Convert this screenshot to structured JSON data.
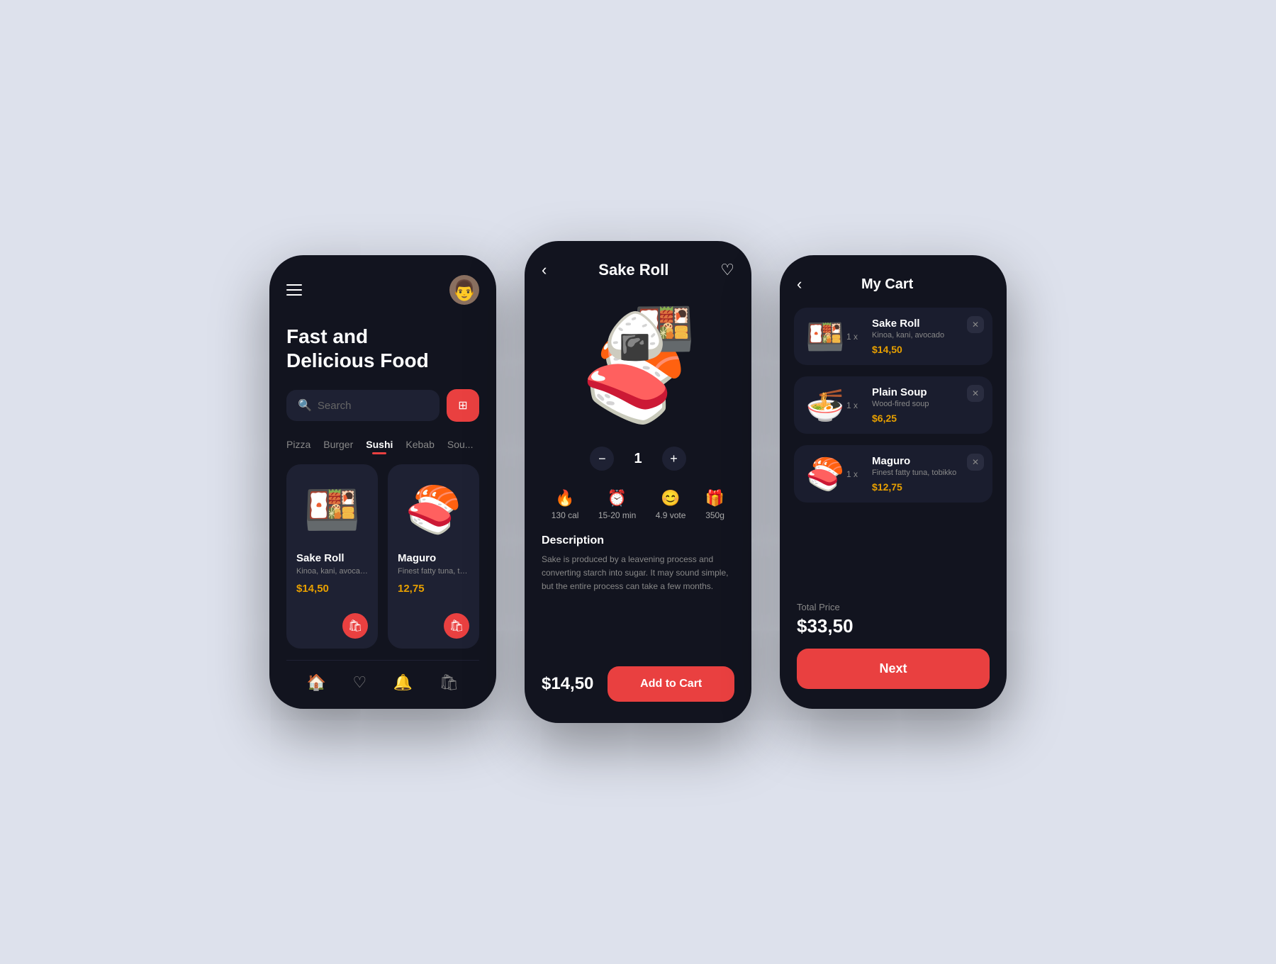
{
  "background": "#dde1ec",
  "phone1": {
    "title_line1": "Fast and",
    "title_line2": "Delicious Food",
    "search_placeholder": "Search",
    "filter_icon": "≡",
    "categories": [
      {
        "label": "Pizza",
        "active": false
      },
      {
        "label": "Burger",
        "active": false
      },
      {
        "label": "Sushi",
        "active": true
      },
      {
        "label": "Kebab",
        "active": false
      },
      {
        "label": "Sou...",
        "active": false
      }
    ],
    "foods": [
      {
        "name": "Sake Roll",
        "desc": "Kinoa, kani, avocado",
        "price": "$14,50",
        "emoji": "🍱"
      },
      {
        "name": "Maguro",
        "desc": "Finest fatty tuna, tobik",
        "price": "12,75",
        "emoji": "🍣"
      }
    ],
    "nav_icons": [
      "🏠",
      "♡",
      "🔔",
      "🛍"
    ]
  },
  "phone2": {
    "title": "Sake Roll",
    "quantity": "1",
    "stats": [
      {
        "emoji": "🔥",
        "value": "130 cal"
      },
      {
        "emoji": "⏰",
        "value": "15-20 min"
      },
      {
        "emoji": "😊",
        "value": "4.9 vote"
      },
      {
        "emoji": "🎁",
        "value": "350g"
      }
    ],
    "description_title": "Description",
    "description_text": "Sake is produced by a leavening process and converting starch into sugar. It may sound simple, but the entire process can take a few months.",
    "price": "$14,50",
    "add_to_cart": "Add to Cart"
  },
  "phone3": {
    "title": "My Cart",
    "items": [
      {
        "name": "Sake Roll",
        "sub": "Kinoa, kani, avocado",
        "price": "$14,50",
        "qty": "1 x",
        "emoji": "🍱"
      },
      {
        "name": "Plain Soup",
        "sub": "Wood-fired soup",
        "price": "$6,25",
        "qty": "1 x",
        "emoji": "🍜"
      },
      {
        "name": "Maguro",
        "sub": "Finest fatty tuna, tobikko",
        "price": "$12,75",
        "qty": "1 x",
        "emoji": "🍣"
      }
    ],
    "total_label": "Total Price",
    "total_price": "$33,50",
    "next_btn": "Next"
  }
}
